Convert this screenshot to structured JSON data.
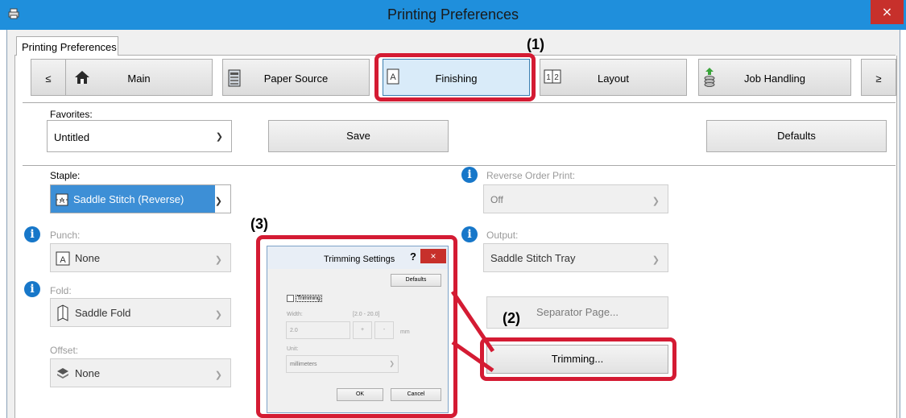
{
  "window": {
    "title": "Printing Preferences",
    "close_glyph": "×"
  },
  "tabs": [
    {
      "label": "Printing Preferences"
    }
  ],
  "nav": {
    "prev": "≤",
    "next": "≥",
    "items": [
      {
        "label": "Main",
        "icon": "home-icon"
      },
      {
        "label": "Paper Source",
        "icon": "printer-icon"
      },
      {
        "label": "Finishing",
        "icon": "finishing-page-icon"
      },
      {
        "label": "Layout",
        "icon": "layout-icon"
      },
      {
        "label": "Job Handling",
        "icon": "job-stack-icon"
      }
    ]
  },
  "favorites": {
    "label": "Favorites:",
    "value": "Untitled",
    "save": "Save",
    "defaults": "Defaults"
  },
  "staple": {
    "label": "Staple:",
    "value": "Saddle Stitch (Reverse)"
  },
  "punch": {
    "label": "Punch:",
    "value": "None"
  },
  "fold": {
    "label": "Fold:",
    "value": "Saddle Fold"
  },
  "offset": {
    "label": "Offset:",
    "value": "None"
  },
  "reverse_order": {
    "label": "Reverse Order Print:",
    "value": "Off"
  },
  "output": {
    "label": "Output:",
    "value": "Saddle Stitch Tray"
  },
  "separator_button": "Separator Page...",
  "trimming_button": "Trimming...",
  "callouts": {
    "c1": "(1)",
    "c2": "(2)",
    "c3": "(3)"
  },
  "dialog": {
    "title": "Trimming Settings",
    "help": "?",
    "close": "×",
    "defaults": "Defaults",
    "trimming_checkbox": "Trimming",
    "width_label": "Width:",
    "range": "[2.0 - 20.0]",
    "width_value": "2.0",
    "plus": "+",
    "minus": "-",
    "unit_suffix": "mm",
    "unit_label": "Unit:",
    "unit_value": "millimeters",
    "ok": "OK",
    "cancel": "Cancel"
  },
  "colors": {
    "titlebar": "#1f8fdc",
    "close": "#c7302b",
    "highlight": "#d41b33",
    "selected_combo": "#3d8fd6",
    "info": "#1777c9"
  }
}
